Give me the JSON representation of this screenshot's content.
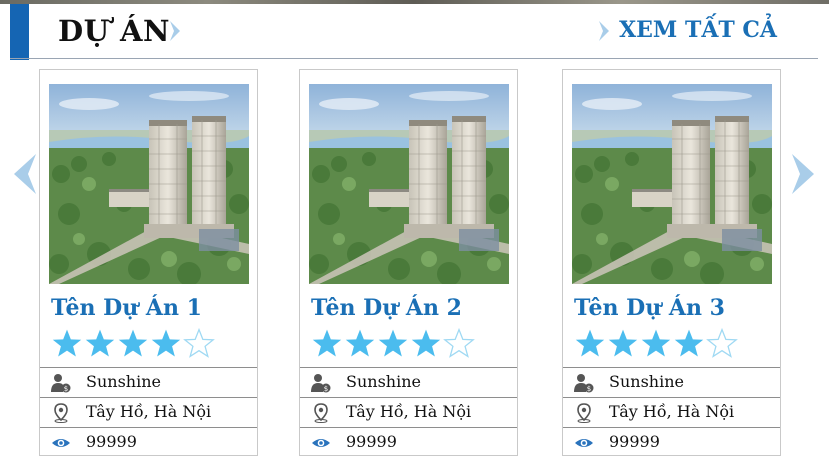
{
  "section": {
    "title": "DỰ ÁN",
    "view_all": "XEM TẤT CẢ"
  },
  "colors": {
    "accent": "#1565b3",
    "link": "#1a6fb5",
    "star": "#4bbcee",
    "chevron": "#a9cde9"
  },
  "projects": [
    {
      "name": "Tên Dự Án 1",
      "rating": 4,
      "rating_max": 5,
      "owner": "Sunshine",
      "location": "Tây Hồ, Hà Nội",
      "views": "99999"
    },
    {
      "name": "Tên Dự Án 2",
      "rating": 4,
      "rating_max": 5,
      "owner": "Sunshine",
      "location": "Tây Hồ, Hà Nội",
      "views": "99999"
    },
    {
      "name": "Tên Dự Án 3",
      "rating": 4,
      "rating_max": 5,
      "owner": "Sunshine",
      "location": "Tây Hồ, Hà Nội",
      "views": "99999"
    }
  ],
  "icons": {
    "owner": "user-money-icon",
    "location": "map-pin-icon",
    "views": "eye-icon",
    "prev": "chevron-left-icon",
    "next": "chevron-right-icon"
  }
}
